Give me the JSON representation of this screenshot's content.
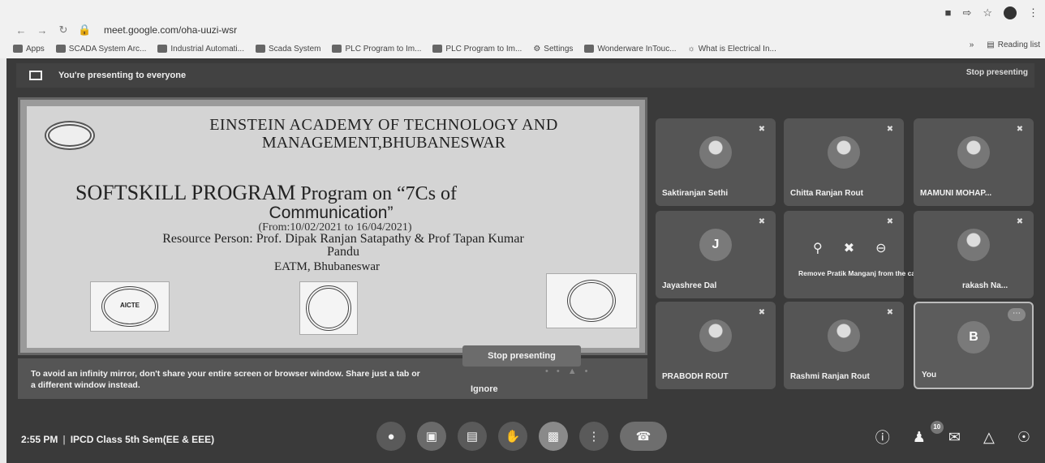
{
  "browser": {
    "url": "meet.google.com/oha-uuzi-wsr",
    "bookmarks": [
      {
        "label": "Apps"
      },
      {
        "label": "SCADA System Arc..."
      },
      {
        "label": "Industrial Automati..."
      },
      {
        "label": "Scada System"
      },
      {
        "label": "PLC Program to Im..."
      },
      {
        "label": "PLC Program to Im..."
      },
      {
        "label": "Settings"
      },
      {
        "label": "Wonderware InTouc..."
      },
      {
        "label": "What is Electrical In..."
      }
    ],
    "reading_list": "Reading list"
  },
  "meet": {
    "presenting_banner": "You're presenting to everyone",
    "stop_presenting_top": "Stop presenting",
    "slide": {
      "title_line1": "EINSTEIN ACADEMY OF TECHNOLOGY AND",
      "title_line2": "MANAGEMENT,BHUBANESWAR",
      "program_bold": "SOFTSKILL PROGRAM",
      "program_rest": " Program on “7Cs of",
      "communication": "Communication”",
      "dates": "(From:10/02/2021 to 16/04/2021)",
      "resource_line1": "Resource Person: Prof. Dipak Ranjan Satapathy & Prof Tapan Kumar",
      "resource_line2": "Pandu",
      "institution": "EATM, Bhubaneswar",
      "logo_aicte": "AICTE"
    },
    "mirror_warning": "To avoid an infinity mirror, don't share your entire screen or browser window. Share just a tab or a different window instead.",
    "stop_presenting_button": "Stop presenting",
    "ignore_button": "Ignore",
    "participants": [
      {
        "name": "Saktiranjan Sethi"
      },
      {
        "name": "Chitta Ranjan Rout"
      },
      {
        "name": "MAMUNI MOHAP..."
      },
      {
        "name": "Jayashree Dal",
        "initial": "J"
      },
      {
        "name": "",
        "hover_label": "Remove Pratik Manganj from the call"
      },
      {
        "name": "rakash Na..."
      },
      {
        "name": "PRABODH ROUT"
      },
      {
        "name": "Rashmi Ranjan Rout"
      },
      {
        "name": "You",
        "initial": "B"
      }
    ],
    "bottom": {
      "time": "2:55 PM",
      "meeting_title": "IPCD Class 5th Sem(EE & EEE)",
      "people_count": "10"
    }
  }
}
